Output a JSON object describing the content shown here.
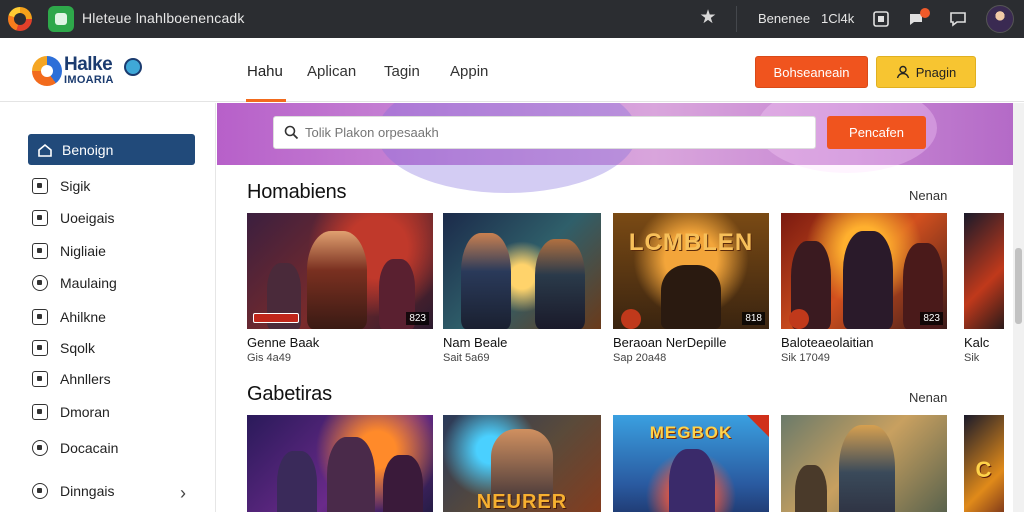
{
  "browser": {
    "url_text": "Hleteue  lnahlboenencadk",
    "right_text_1": "Benenee",
    "right_text_2": "1Cl4k"
  },
  "header": {
    "brand_name": "Halke",
    "brand_sub": "IMOARIA",
    "nav": [
      "Hahu",
      "Aplican",
      "Tagin",
      "Appin"
    ],
    "btn_primary": "Bohseaneain",
    "btn_secondary": "Pnagin"
  },
  "sidebar": {
    "active_label": "Benoign",
    "items": [
      "Sigik",
      "Uoeigais",
      "Nigliaie",
      "Maulaing",
      "Ahilkne",
      "Sqolk",
      "Ahnllers",
      "Dmoran",
      "Docacain",
      "Dinngais"
    ]
  },
  "search": {
    "placeholder": "Tolik Plakon orpesaakh",
    "button": "Pencafen"
  },
  "sections": [
    {
      "title": "Homabiens",
      "more": "Nenan",
      "cards": [
        {
          "title": "Genne Baak",
          "sub": "Gis 4a49",
          "duration": "823",
          "headline": ""
        },
        {
          "title": "Nam Beale",
          "sub": "Sait 5a69",
          "duration": "",
          "headline": ""
        },
        {
          "title": "Beraoan NerDepille",
          "sub": "Sap 20a48",
          "duration": "818",
          "headline": "LCMBLEN"
        },
        {
          "title": "Baloteaeolaitian",
          "sub": "Sik 17049",
          "duration": "823",
          "headline": ""
        },
        {
          "title": "Kalc",
          "sub": "Sik",
          "duration": "",
          "headline": ""
        }
      ]
    },
    {
      "title": "Gabetiras",
      "more": "Nenan",
      "cards": [
        {
          "headline": ""
        },
        {
          "headline": "NEURER"
        },
        {
          "headline": "MEGBOK"
        },
        {
          "headline": ""
        },
        {
          "headline": "C"
        }
      ]
    }
  ],
  "colors": {
    "accent_orange": "#f0541e",
    "accent_yellow": "#f7c531",
    "sidebar_active": "#214a7a",
    "hero_purple": "#c98ad6"
  }
}
